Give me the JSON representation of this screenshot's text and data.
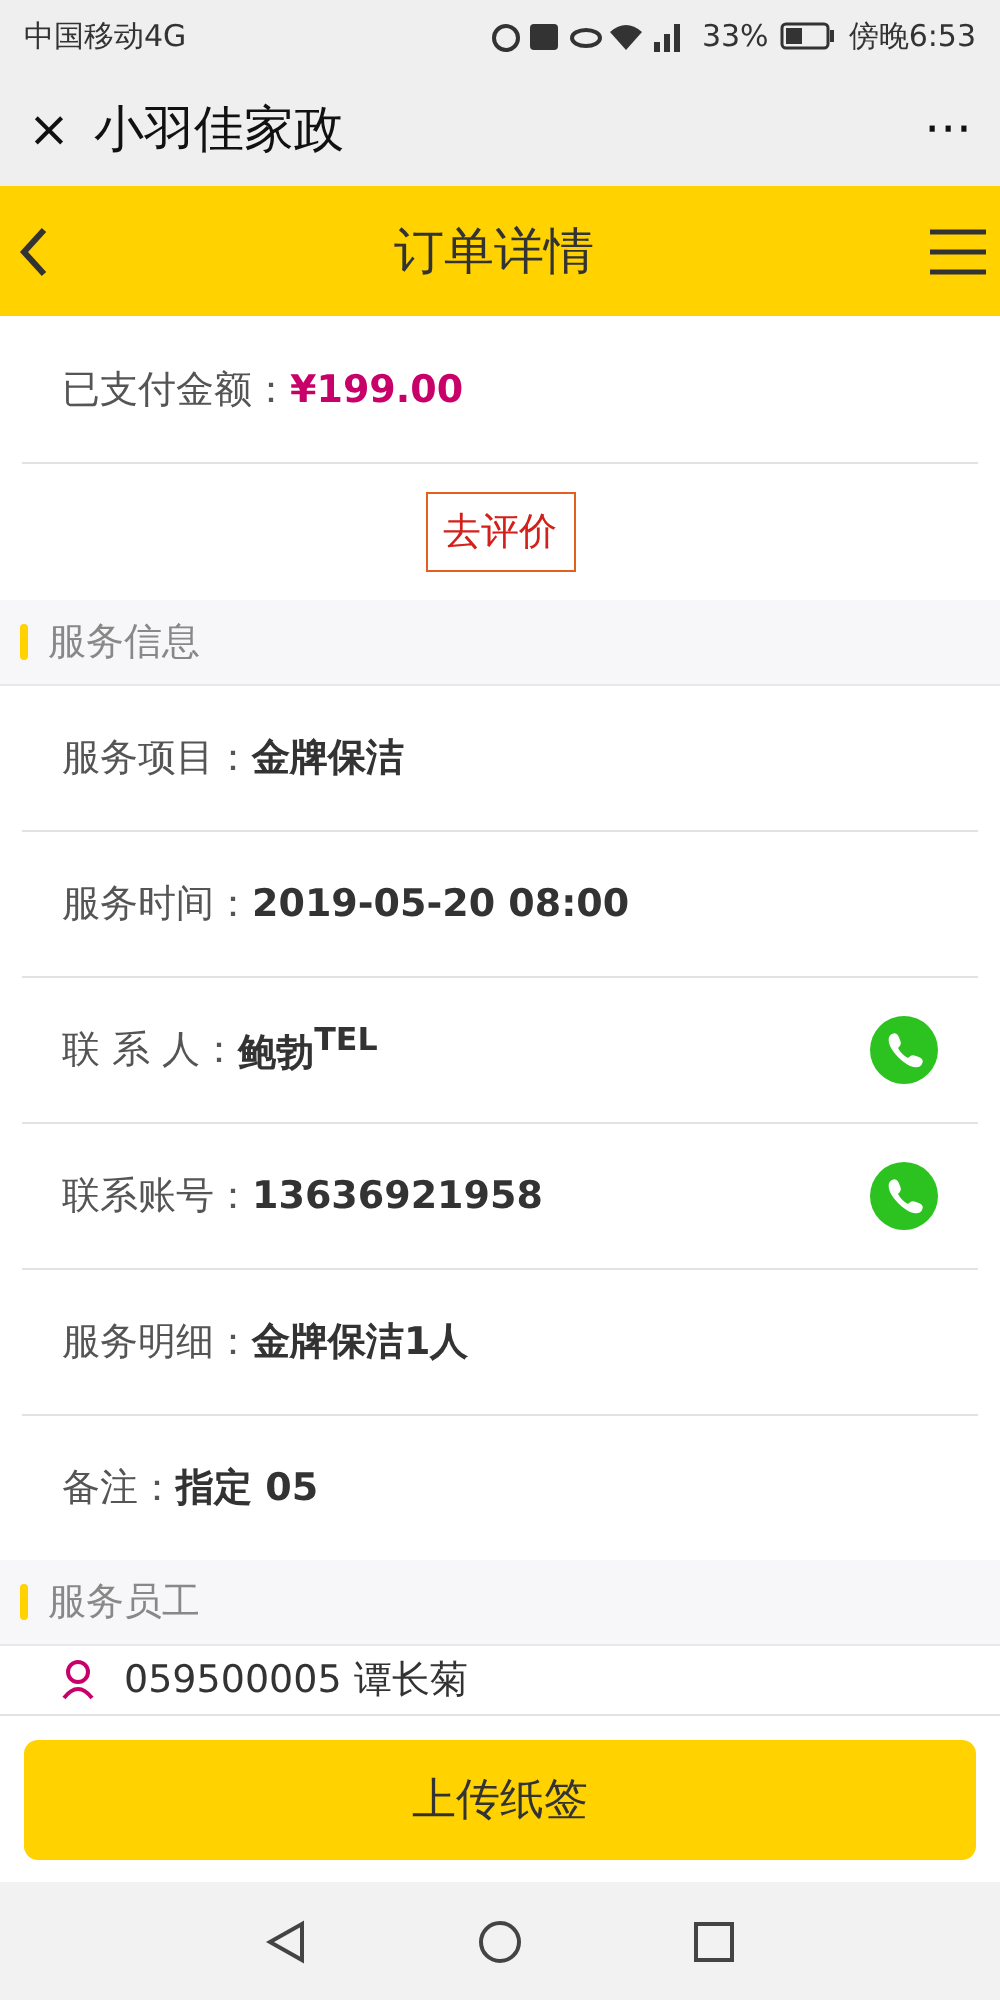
{
  "status_bar": {
    "carrier": "中国移动4G",
    "battery": "33%",
    "time": "傍晚6:53"
  },
  "browser_bar": {
    "close": "×",
    "title": "小羽佳家政",
    "more": "···"
  },
  "header": {
    "title": "订单详情"
  },
  "payment": {
    "label": "已支付金额：",
    "amount": "¥199.00"
  },
  "review_button": "去评价",
  "sections": [
    {
      "title": "服务信息",
      "rows": [
        {
          "kind": "plain",
          "label": "服务项目：",
          "value": "金牌保洁"
        },
        {
          "kind": "plain",
          "label": "服务时间：",
          "value": "2019-05-20 08:00"
        },
        {
          "kind": "phone",
          "label": "联 系 人：",
          "value": "鲍勃$^{TEL}$"
        },
        {
          "kind": "phone",
          "label": "联系账号：",
          "value": "13636921958"
        },
        {
          "kind": "plain",
          "label": "服务明细：",
          "value": "金牌保洁1人"
        },
        {
          "kind": "plain",
          "label": "备注：",
          "value": "指定 05"
        }
      ]
    },
    {
      "title": "服务员工",
      "rows": [
        {
          "kind": "staff",
          "label": "",
          "value": "059500005 谭长菊"
        }
      ]
    }
  ],
  "footer_button": "上传纸签"
}
